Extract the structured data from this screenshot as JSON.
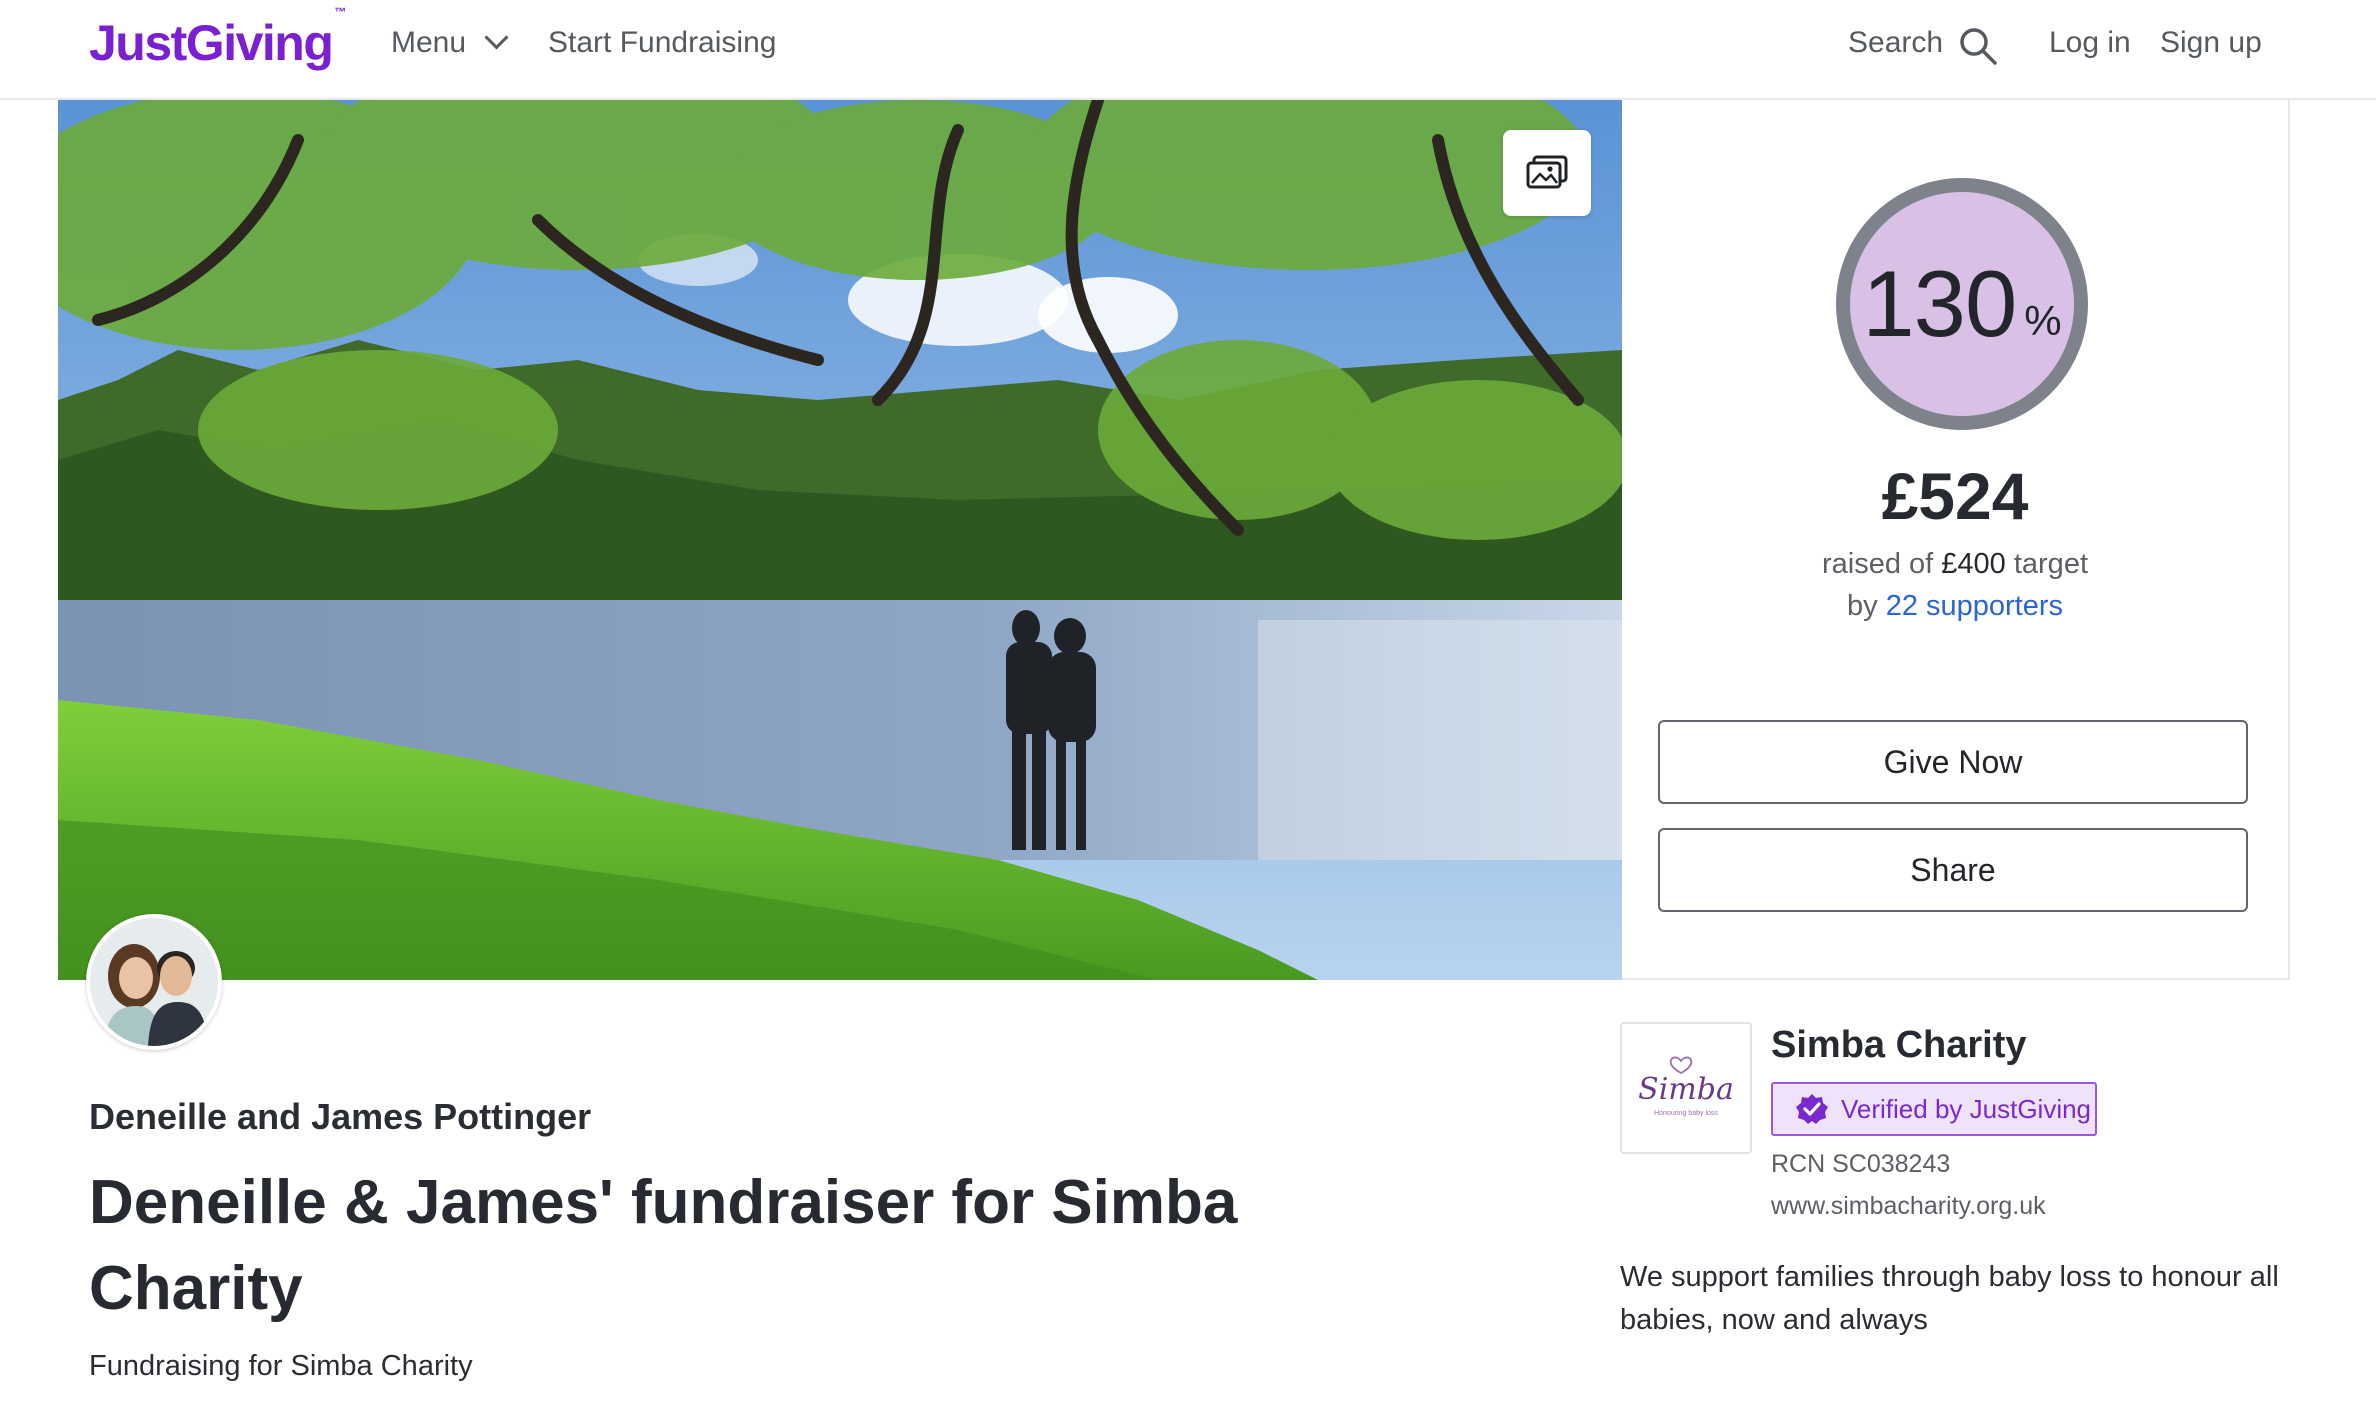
{
  "header": {
    "logo": "JustGiving",
    "logo_tm": "™",
    "menu_label": "Menu",
    "start_fundraising": "Start Fundraising",
    "search_label": "Search",
    "login_label": "Log in",
    "signup_label": "Sign up"
  },
  "hero": {
    "gallery_icon": "image-gallery-icon"
  },
  "progress": {
    "percent": "130",
    "percent_sign": "%",
    "fraction": 1.0,
    "raised": "£524",
    "raised_of": "raised of",
    "target_amount": "£400",
    "target_word": "target",
    "by": "by",
    "supporters": "22 supporters"
  },
  "actions": {
    "give_now": "Give Now",
    "share": "Share"
  },
  "fundraiser": {
    "owner": "Deneille and James Pottinger",
    "title": "Deneille & James' fundraiser for Simba Charity",
    "subtitle": "Fundraising for Simba Charity"
  },
  "charity": {
    "name": "Simba Charity",
    "verified": "Verified by JustGiving",
    "rcn": "RCN SC038243",
    "website": "www.simbacharity.org.uk",
    "description": "We support families through baby loss to honour all babies, now and always",
    "logo_text": "Simba",
    "logo_tagline": "Honouring baby loss"
  },
  "colors": {
    "brand": "#7a1fd1",
    "link": "#2c64d6",
    "ring": "#7e828b",
    "ring_fill": "#d9c1e6",
    "verified_bg": "#efe3fb"
  }
}
